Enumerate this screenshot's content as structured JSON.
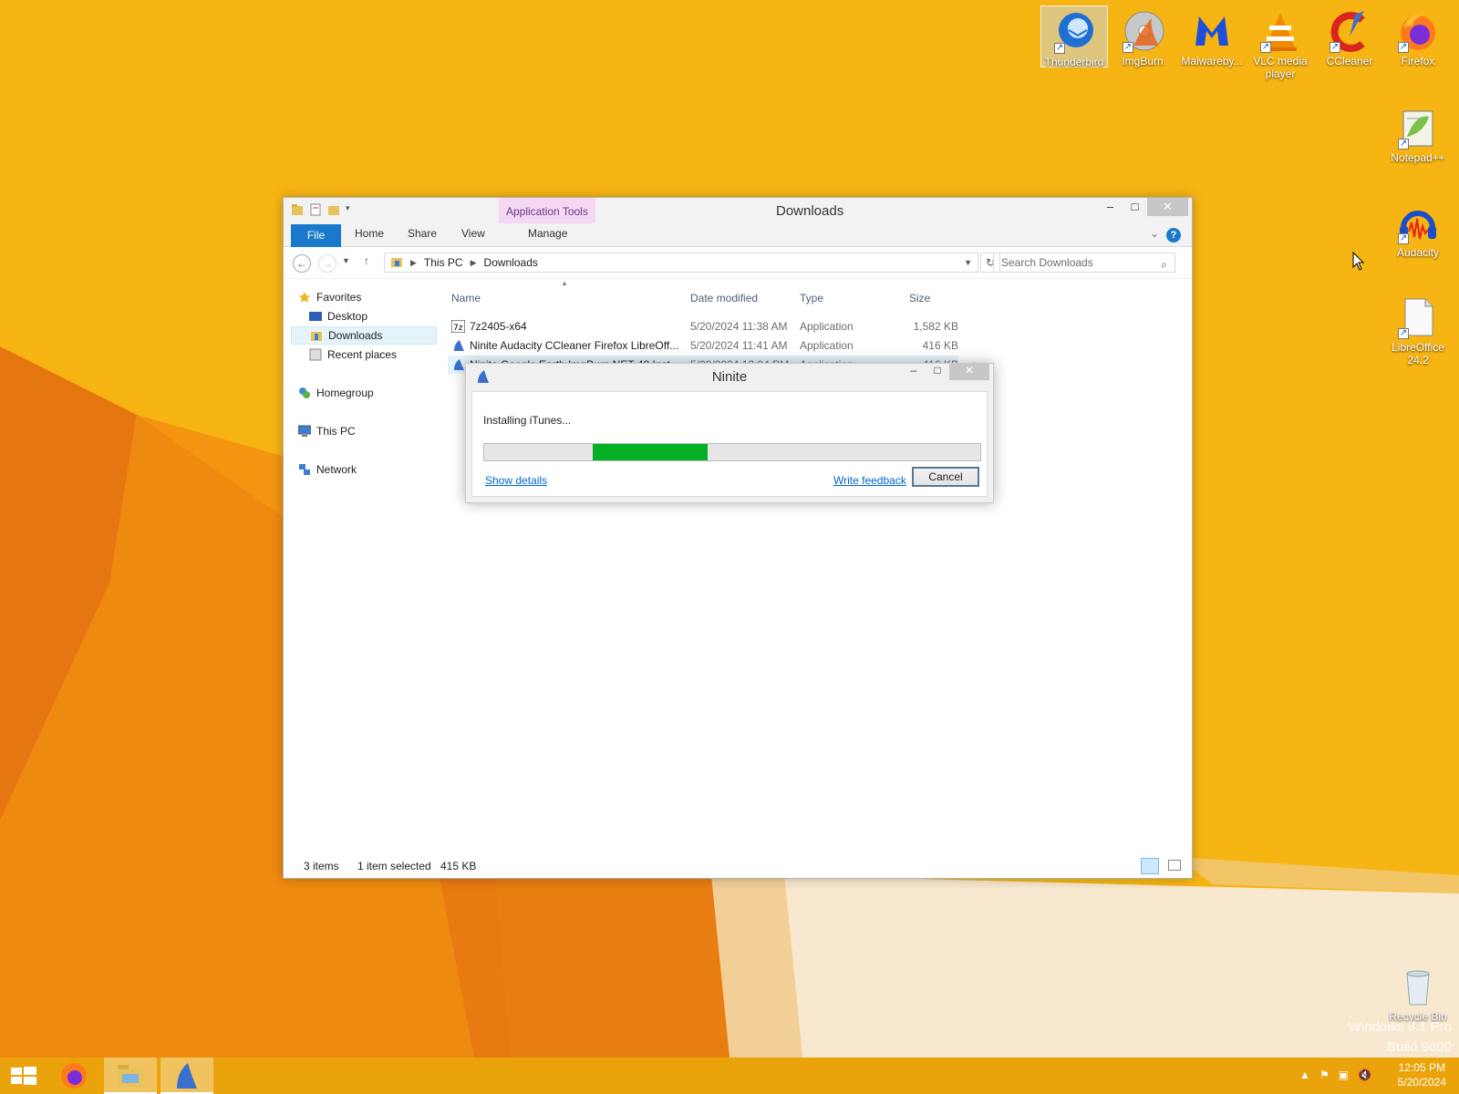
{
  "desktop": {
    "icons": [
      {
        "label": "Thunderbird",
        "icon": "thunderbird-icon"
      },
      {
        "label": "ImgBurn",
        "icon": "imgburn-icon"
      },
      {
        "label": "Malwareby...",
        "icon": "malwarebytes-icon"
      },
      {
        "label": "VLC media player",
        "icon": "vlc-icon"
      },
      {
        "label": "CCleaner",
        "icon": "ccleaner-icon"
      },
      {
        "label": "Firefox",
        "icon": "firefox-icon"
      },
      {
        "label": "Notepad++",
        "icon": "notepadpp-icon"
      },
      {
        "label": "Audacity",
        "icon": "audacity-icon"
      },
      {
        "label": "LibreOffice 24.2",
        "icon": "libreoffice-icon"
      },
      {
        "label": "Recycle Bin",
        "icon": "recycle-bin-icon"
      }
    ],
    "watermark_line1": "Windows 8.1 Pro",
    "watermark_line2": "Build 9600"
  },
  "explorer": {
    "title": "Downloads",
    "context_tab": "Application Tools",
    "ribbon_tabs": [
      "File",
      "Home",
      "Share",
      "View",
      "Manage"
    ],
    "address": [
      "This PC",
      "Downloads"
    ],
    "search_placeholder": "Search Downloads",
    "nav": {
      "favorites": "Favorites",
      "desktop": "Desktop",
      "downloads": "Downloads",
      "recent": "Recent places",
      "homegroup": "Homegroup",
      "this_pc": "This PC",
      "network": "Network"
    },
    "columns": {
      "name": "Name",
      "date": "Date modified",
      "type": "Type",
      "size": "Size"
    },
    "files": [
      {
        "name": "7z2405-x64",
        "date": "5/20/2024 11:38 AM",
        "type": "Application",
        "size": "1,582 KB",
        "icon": "7zip-icon"
      },
      {
        "name": "Ninite Audacity CCleaner Firefox LibreOff...",
        "date": "5/20/2024 11:41 AM",
        "type": "Application",
        "size": "416 KB",
        "icon": "ninite-icon"
      },
      {
        "name": "Ninite Google Earth ImgBurn NET 48 Inst...",
        "date": "5/20/2024 12:04 PM",
        "type": "Application",
        "size": "416 KB",
        "icon": "ninite-icon"
      }
    ],
    "status": {
      "items": "3 items",
      "selected": "1 item selected",
      "size": "415 KB"
    }
  },
  "ninite": {
    "title": "Ninite",
    "status": "Installing iTunes...",
    "progress_start": 0.218,
    "progress_end": 0.451,
    "show_details": "Show details",
    "write_feedback": "Write feedback",
    "cancel": "Cancel"
  },
  "taskbar": {
    "time": "12:05 PM",
    "date": "5/20/2024"
  }
}
